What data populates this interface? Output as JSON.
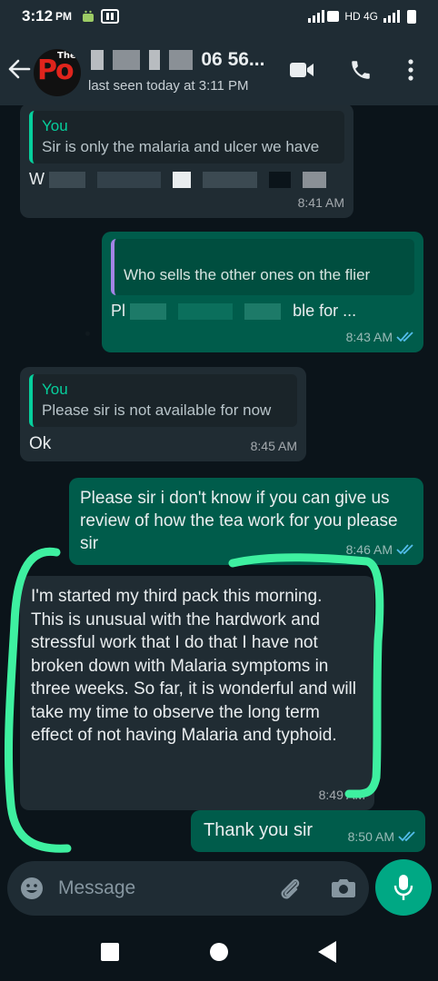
{
  "status_bar": {
    "time": "3:12",
    "ampm": "PM",
    "network": "HD 4G"
  },
  "header": {
    "avatar_brand": "The",
    "avatar_letters": "Po",
    "contact_name_visible": "06 56...",
    "last_seen": "last seen today at 3:11 PM"
  },
  "messages": [
    {
      "direction": "in",
      "quote_author": "You",
      "quote_text": "Sir is only the malaria and ulcer we have",
      "text_prefix": "W",
      "time": "8:41 AM"
    },
    {
      "direction": "out",
      "quote_text": "Who sells the other ones on the flier",
      "text_prefix": "Pl",
      "text_suffix": "ble for ...",
      "time": "8:43 AM",
      "status": "read"
    },
    {
      "direction": "in",
      "quote_author": "You",
      "quote_text": "Please sir is not available for now",
      "text": "Ok",
      "time": "8:45 AM"
    },
    {
      "direction": "out",
      "text": "Please sir i don't know if you can give us review of how the tea work for you please sir",
      "time": "8:46 AM",
      "status": "read"
    },
    {
      "direction": "in",
      "text": "I'm started my third pack this morning. This is unusual with the hardwork and stressful work that I do that I have not broken down with Malaria symptoms in three weeks. So far, it is wonderful and will take my time to observe the long term effect of not having Malaria and typhoid.",
      "time": "8:49 AM"
    },
    {
      "direction": "out",
      "text": "Thank you sir",
      "time": "8:50 AM",
      "status": "read"
    }
  ],
  "composer": {
    "placeholder": "Message"
  },
  "icons": {
    "back": "back-arrow-icon",
    "video": "video-call-icon",
    "call": "phone-icon",
    "menu": "more-vert-icon",
    "emoji": "emoji-icon",
    "attach": "paperclip-icon",
    "camera": "camera-icon",
    "mic": "microphone-icon"
  },
  "colors": {
    "incoming_bubble": "#202c33",
    "outgoing_bubble": "#005c4b",
    "accent": "#00a884",
    "highlighter": "#3ef0a0"
  }
}
